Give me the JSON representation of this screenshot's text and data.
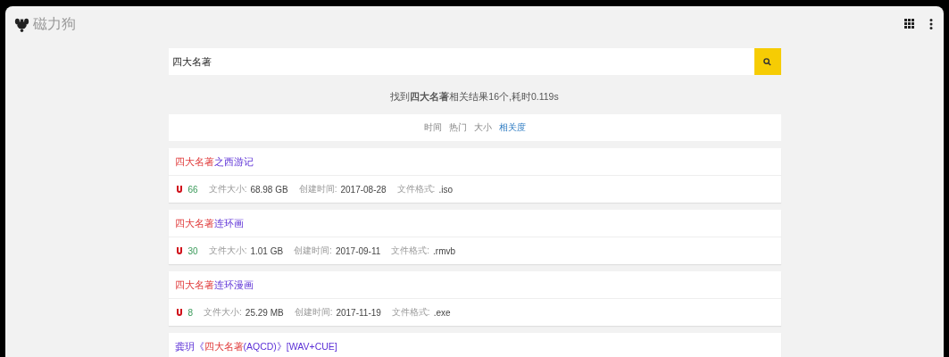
{
  "header": {
    "site_name": "磁力狗"
  },
  "search": {
    "value": "四大名著"
  },
  "summary": "找到**四大名著**相关结果16个,耗时0.119s",
  "sort_options": [
    {
      "label": "时间",
      "selected": false
    },
    {
      "label": "热门",
      "selected": false
    },
    {
      "label": "大小",
      "selected": false
    },
    {
      "label": "相关度",
      "selected": true
    }
  ],
  "results": [
    {
      "title": [
        {
          "text": "四大名著",
          "highlight": true
        },
        {
          "text": "之西游记",
          "highlight": false
        }
      ],
      "meta": {
        "heat": "66",
        "size_label": "文件大小:",
        "size": "68.98 GB",
        "date_label": "创建时间:",
        "date": "2017-08-28",
        "format_label": "文件格式:",
        "format": ".iso"
      }
    },
    {
      "title": [
        {
          "text": "四大名著",
          "highlight": true
        },
        {
          "text": "连环画",
          "highlight": false
        }
      ],
      "meta": {
        "heat": "30",
        "size_label": "文件大小:",
        "size": "1.01 GB",
        "date_label": "创建时间:",
        "date": "2017-09-11",
        "format_label": "文件格式:",
        "format": ".rmvb"
      }
    },
    {
      "title": [
        {
          "text": "四大名著",
          "highlight": true
        },
        {
          "text": "连环漫画",
          "highlight": false
        }
      ],
      "meta": {
        "heat": "8",
        "size_label": "文件大小:",
        "size": "25.29 MB",
        "date_label": "创建时间:",
        "date": "2017-11-19",
        "format_label": "文件格式:",
        "format": ".exe"
      }
    },
    {
      "title": [
        {
          "text": "龚玥《",
          "highlight": false
        },
        {
          "text": "四大名著",
          "highlight": true
        },
        {
          "text": "(AQCD)》[WAV+CUE]",
          "highlight": false
        }
      ]
    }
  ]
}
